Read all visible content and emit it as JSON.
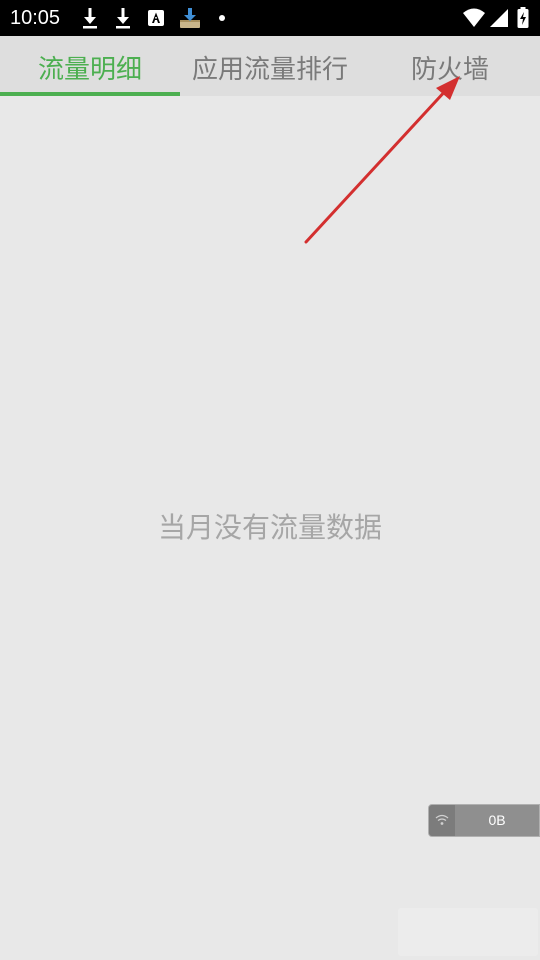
{
  "status_bar": {
    "time": "10:05",
    "notification_icons": [
      "download-icon",
      "download-icon",
      "font-app-icon",
      "install-box-icon",
      "dot-icon"
    ],
    "system_icons": [
      "wifi-icon",
      "signal-icon",
      "battery-icon"
    ]
  },
  "tabs": [
    {
      "label": "流量明细",
      "active": true
    },
    {
      "label": "应用流量排行",
      "active": false
    },
    {
      "label": "防火墙",
      "active": false
    }
  ],
  "empty_message": "当月没有流量数据",
  "traffic_widget": {
    "icon": "wifi-icon",
    "value": "0B"
  },
  "colors": {
    "accent": "#4caf50",
    "annotation_arrow": "#d32f2f",
    "background": "#e8e8e8",
    "tab_bar": "#dedede"
  }
}
